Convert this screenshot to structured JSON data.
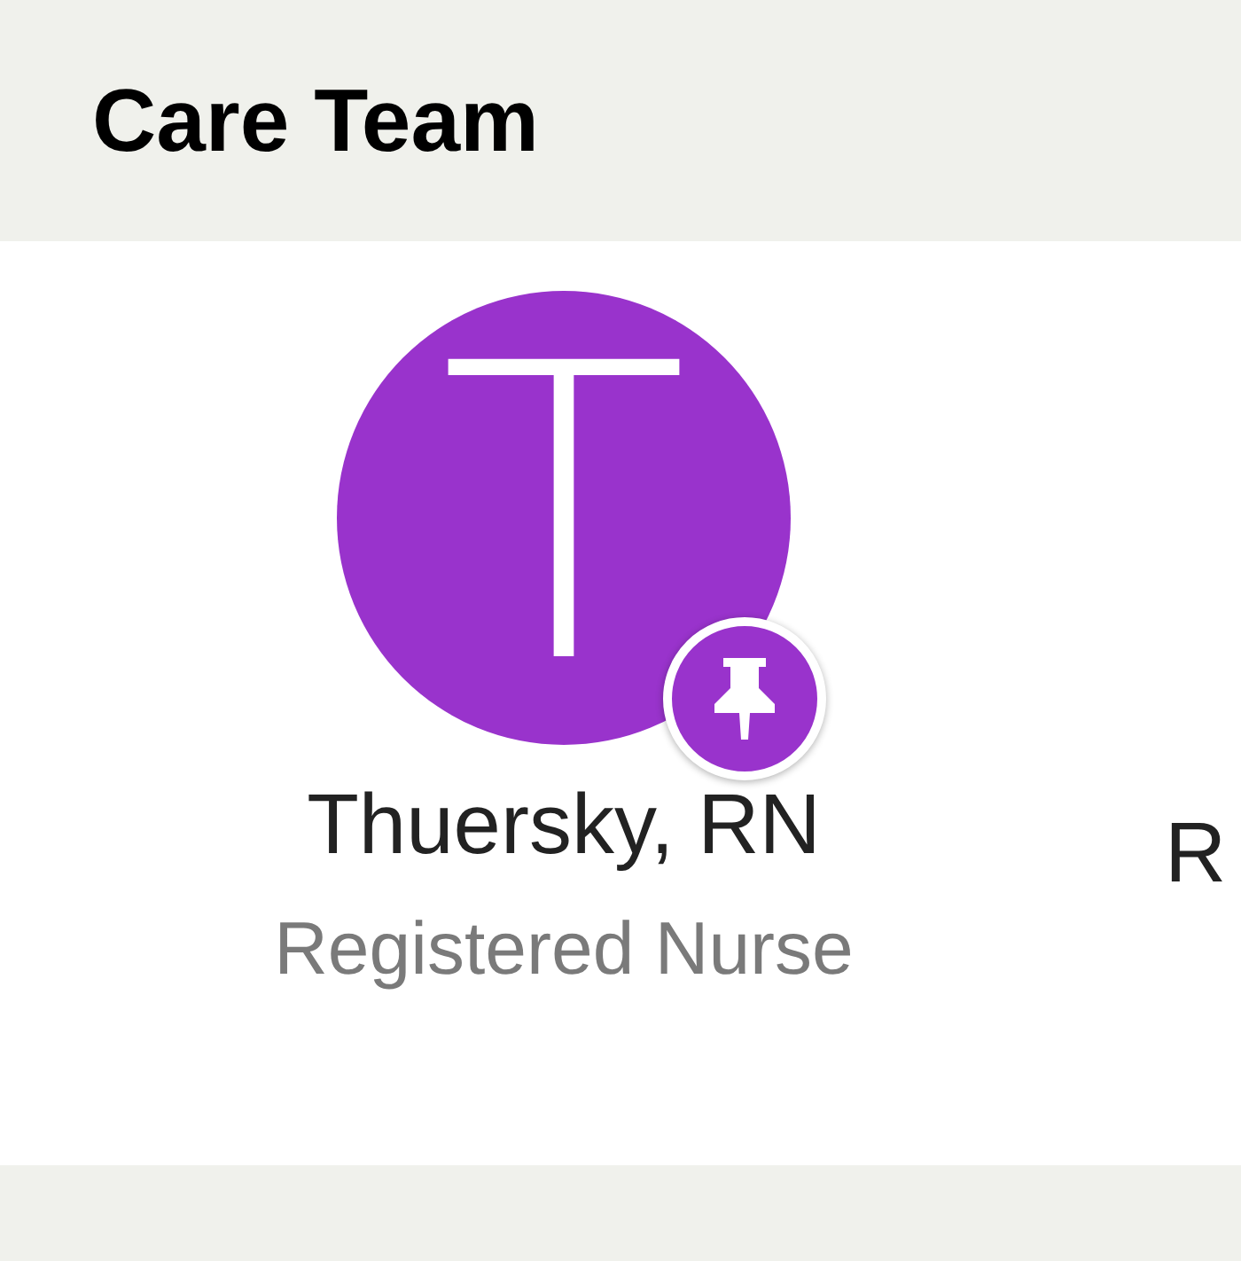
{
  "header": {
    "title": "Care Team"
  },
  "members": [
    {
      "initial": "T",
      "name": "Thuersky, RN",
      "role": "Registered Nurse",
      "pinned": true,
      "color": "#9933cc"
    },
    {
      "name": "R"
    }
  ]
}
